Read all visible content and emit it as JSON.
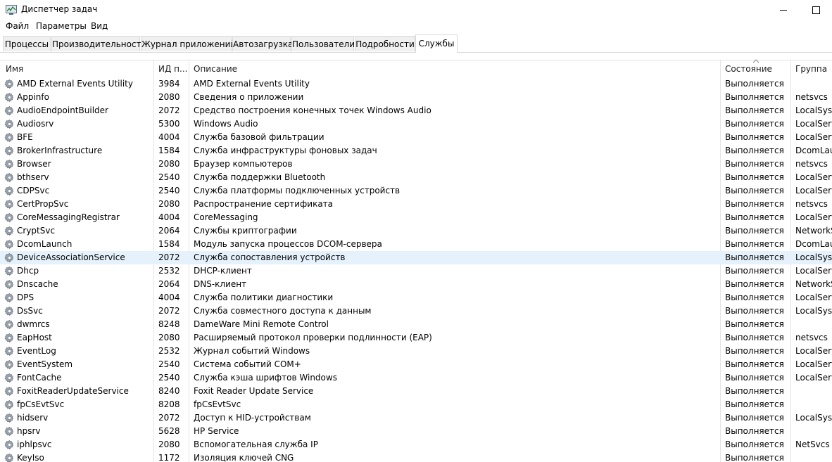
{
  "window": {
    "title": "Диспетчер задач"
  },
  "menu": [
    "Файл",
    "Параметры",
    "Вид"
  ],
  "tabs": [
    {
      "label": "Процессы",
      "active": false
    },
    {
      "label": "Производительность",
      "active": false
    },
    {
      "label": "Журнал приложений",
      "active": false
    },
    {
      "label": "Автозагрузка",
      "active": false
    },
    {
      "label": "Пользователи",
      "active": false
    },
    {
      "label": "Подробности",
      "active": false
    },
    {
      "label": "Службы",
      "active": true
    }
  ],
  "columns": [
    "Имя",
    "ИД п...",
    "Описание",
    "Состояние",
    "Группа"
  ],
  "selected_row": "DeviceAssociationService",
  "services": [
    {
      "name": "AMD External Events Utility",
      "pid": "3984",
      "desc": "AMD External Events Utility",
      "state": "Выполняется",
      "group": ""
    },
    {
      "name": "Appinfo",
      "pid": "2080",
      "desc": "Сведения о приложении",
      "state": "Выполняется",
      "group": "netsvcs"
    },
    {
      "name": "AudioEndpointBuilder",
      "pid": "2072",
      "desc": "Средство построения конечных точек Windows Audio",
      "state": "Выполняется",
      "group": "LocalSyste"
    },
    {
      "name": "Audiosrv",
      "pid": "5300",
      "desc": "Windows Audio",
      "state": "Выполняется",
      "group": "LocalServi"
    },
    {
      "name": "BFE",
      "pid": "4004",
      "desc": "Служба базовой фильтрации",
      "state": "Выполняется",
      "group": "LocalServi"
    },
    {
      "name": "BrokerInfrastructure",
      "pid": "1584",
      "desc": "Служба инфраструктуры фоновых задач",
      "state": "Выполняется",
      "group": "DcomLaun"
    },
    {
      "name": "Browser",
      "pid": "2080",
      "desc": "Браузер компьютеров",
      "state": "Выполняется",
      "group": "netsvcs"
    },
    {
      "name": "bthserv",
      "pid": "2540",
      "desc": "Служба поддержки Bluetooth",
      "state": "Выполняется",
      "group": "LocalServi"
    },
    {
      "name": "CDPSvc",
      "pid": "2540",
      "desc": "Служба платформы подключенных устройств",
      "state": "Выполняется",
      "group": "LocalServi"
    },
    {
      "name": "CertPropSvc",
      "pid": "2080",
      "desc": "Распространение сертификата",
      "state": "Выполняется",
      "group": "netsvcs"
    },
    {
      "name": "CoreMessagingRegistrar",
      "pid": "4004",
      "desc": "CoreMessaging",
      "state": "Выполняется",
      "group": "LocalServi"
    },
    {
      "name": "CryptSvc",
      "pid": "2064",
      "desc": "Службы криптографии",
      "state": "Выполняется",
      "group": "NetworkS"
    },
    {
      "name": "DcomLaunch",
      "pid": "1584",
      "desc": "Модуль запуска процессов DCOM-сервера",
      "state": "Выполняется",
      "group": "DcomLaun"
    },
    {
      "name": "DeviceAssociationService",
      "pid": "2072",
      "desc": "Служба сопоставления устройств",
      "state": "Выполняется",
      "group": "LocalSyste"
    },
    {
      "name": "Dhcp",
      "pid": "2532",
      "desc": "DHCP-клиент",
      "state": "Выполняется",
      "group": "LocalServi"
    },
    {
      "name": "Dnscache",
      "pid": "2064",
      "desc": "DNS-клиент",
      "state": "Выполняется",
      "group": "NetworkS"
    },
    {
      "name": "DPS",
      "pid": "4004",
      "desc": "Служба политики диагностики",
      "state": "Выполняется",
      "group": "LocalServi"
    },
    {
      "name": "DsSvc",
      "pid": "2072",
      "desc": "Служба совместного доступа к данным",
      "state": "Выполняется",
      "group": "LocalSyste"
    },
    {
      "name": "dwmrcs",
      "pid": "8248",
      "desc": "DameWare Mini Remote Control",
      "state": "Выполняется",
      "group": ""
    },
    {
      "name": "EapHost",
      "pid": "2080",
      "desc": "Расширяемый протокол проверки подлинности (EAP)",
      "state": "Выполняется",
      "group": "netsvcs"
    },
    {
      "name": "EventLog",
      "pid": "2532",
      "desc": "Журнал событий Windows",
      "state": "Выполняется",
      "group": "LocalServi"
    },
    {
      "name": "EventSystem",
      "pid": "2540",
      "desc": "Система событий COM+",
      "state": "Выполняется",
      "group": "LocalServi"
    },
    {
      "name": "FontCache",
      "pid": "2540",
      "desc": "Служба кэша шрифтов Windows",
      "state": "Выполняется",
      "group": "LocalServi"
    },
    {
      "name": "FoxitReaderUpdateService",
      "pid": "8240",
      "desc": "Foxit Reader Update Service",
      "state": "Выполняется",
      "group": ""
    },
    {
      "name": "fpCsEvtSvc",
      "pid": "8208",
      "desc": "fpCsEvtSvc",
      "state": "Выполняется",
      "group": ""
    },
    {
      "name": "hidserv",
      "pid": "2072",
      "desc": "Доступ к HID-устройствам",
      "state": "Выполняется",
      "group": "LocalSyste"
    },
    {
      "name": "hpsrv",
      "pid": "5628",
      "desc": "HP Service",
      "state": "Выполняется",
      "group": ""
    },
    {
      "name": "iphlpsvc",
      "pid": "2080",
      "desc": "Вспомогательная служба IP",
      "state": "Выполняется",
      "group": "NetSvcs"
    },
    {
      "name": "KeyIso",
      "pid": "1172",
      "desc": "Изоляция ключей CNG",
      "state": "Выполняется",
      "group": ""
    }
  ]
}
